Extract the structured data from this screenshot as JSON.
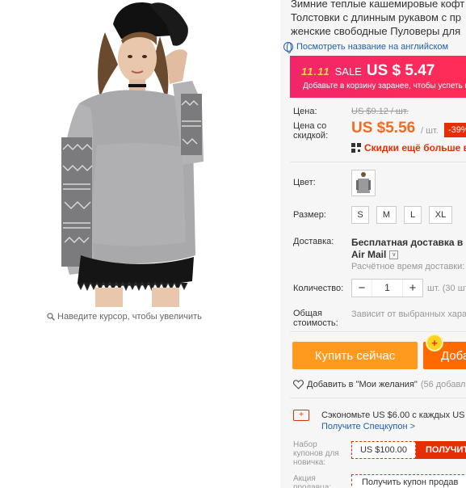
{
  "gallery": {
    "zoom_hint": "Наведите курсор, чтобы увеличить"
  },
  "product": {
    "title_lines": [
      "Зимние теплые кашемировые кофт",
      "Толстовки с длинным рукавом с пр",
      "женские свободные Пуловеры для"
    ],
    "translate_link": "Посмотреть название на английском"
  },
  "sale": {
    "logo": "11.11",
    "word": "SALE",
    "price": "US $ 5.47",
    "subtitle": "Добавьте в корзину заранее, чтобы успеть к"
  },
  "price": {
    "label": "Цена:",
    "old": "US $9.12 / шт.",
    "discount_label": "Цена со скидкой:",
    "new": "US $5.56",
    "unit": "/ шт.",
    "discount": "-39%",
    "app_offer": "Скидки ещё больше в при"
  },
  "options": {
    "color_label": "Цвет:",
    "size_label": "Размер:",
    "sizes": [
      "S",
      "M",
      "L",
      "XL"
    ]
  },
  "shipping": {
    "label": "Доставка:",
    "main": "Бесплатная доставка в Rus",
    "method": "Air Mail",
    "dropdown": "∨",
    "time": "Расчётное время доставки: 2"
  },
  "quantity": {
    "label": "Количество:",
    "minus": "−",
    "value": "1",
    "plus": "+",
    "note": "шт. (30 шт"
  },
  "total": {
    "label": "Общая стоимость:",
    "note": "Зависит от выбранных харак"
  },
  "actions": {
    "buy_now": "Купить сейчас",
    "add_to_cart": "Доба",
    "cart_badge": "+",
    "wishlist": "Добавить в \"Мои желания\"",
    "wishlist_count": "(56 добавлений"
  },
  "coupons": {
    "save_text": "Сэкономьте US $6.00 с каждых US $6",
    "save_link": "Получите Спецкупон >",
    "newbie_label": "Набор купонов для новичка:",
    "newbie_value": "US $100.00",
    "newbie_get": "ПОЛУЧИТ",
    "seller_label": "Акция продавца:",
    "seller_value": "Получить купон продав"
  },
  "colors": {
    "accent_red": "#e62e04",
    "price_orange": "#f36b20",
    "buy_orange": "#ff9a1e",
    "cart_orange": "#ff6a00",
    "sale_pink": "#f2256a",
    "link_blue": "#1e5fb3"
  }
}
